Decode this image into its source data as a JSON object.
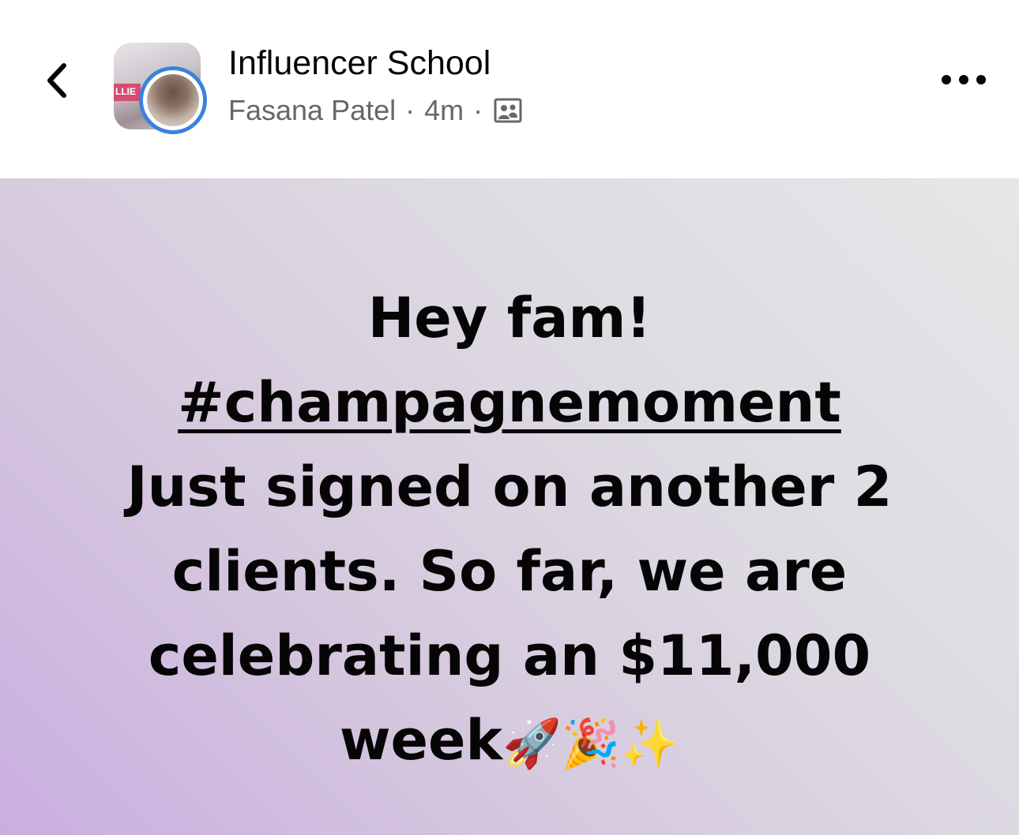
{
  "header": {
    "group_name": "Influencer School",
    "author": "Fasana Patel",
    "separator": "·",
    "time_ago": "4m",
    "group_photo_label": "LLIE",
    "back_icon": "chevron-left-icon",
    "more_icon": "more-horizontal-icon",
    "audience_icon": "group-members-icon"
  },
  "post": {
    "line1": "Hey fam!",
    "hashtag": "#champagnemoment",
    "line3": "Just signed on another 2",
    "line4": "clients. So far, we are",
    "line5": "celebrating an $11,000",
    "line6": "week",
    "emojis": "🚀🎉✨",
    "background_colors": [
      "#e6e6e8",
      "#c9aee0"
    ]
  },
  "colors": {
    "accent_ring": "#3b82dc",
    "meta_text": "#65676b",
    "text": "#050505"
  }
}
